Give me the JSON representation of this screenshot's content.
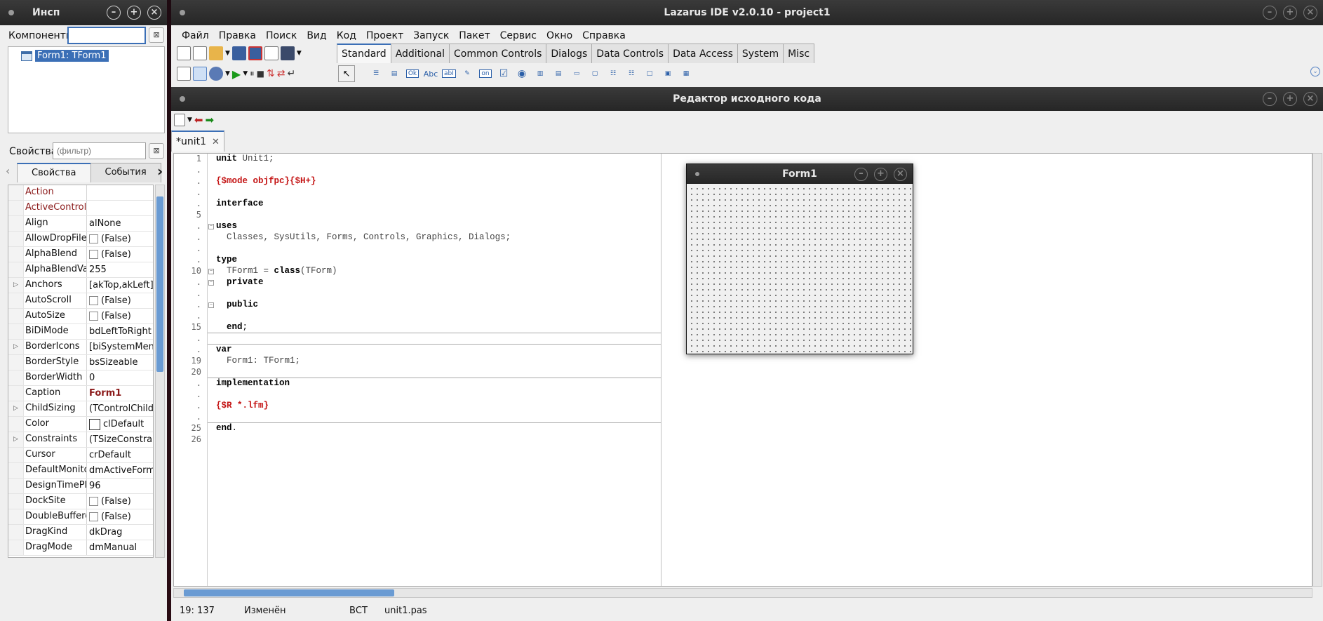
{
  "inspector": {
    "title": "Инсп",
    "components_label": "Компоненты",
    "components_value": "",
    "tree_item": "Form1: TForm1",
    "properties_label": "Свойства",
    "filter_placeholder": "(фильтр)",
    "tabs": [
      "Свойства",
      "События"
    ],
    "properties": [
      {
        "name": "Action",
        "value": "",
        "red": true
      },
      {
        "name": "ActiveControl",
        "value": "",
        "red": true
      },
      {
        "name": "Align",
        "value": "alNone"
      },
      {
        "name": "AllowDropFiles",
        "value": "(False)",
        "checkbox": true
      },
      {
        "name": "AlphaBlend",
        "value": "(False)",
        "checkbox": true
      },
      {
        "name": "AlphaBlendValue",
        "value": "255"
      },
      {
        "name": "Anchors",
        "value": "[akTop,akLeft]",
        "expand": true
      },
      {
        "name": "AutoScroll",
        "value": "(False)",
        "checkbox": true
      },
      {
        "name": "AutoSize",
        "value": "(False)",
        "checkbox": true
      },
      {
        "name": "BiDiMode",
        "value": "bdLeftToRight"
      },
      {
        "name": "BorderIcons",
        "value": "[biSystemMenu",
        "expand": true
      },
      {
        "name": "BorderStyle",
        "value": "bsSizeable"
      },
      {
        "name": "BorderWidth",
        "value": "0"
      },
      {
        "name": "Caption",
        "value": "Form1",
        "bold": true
      },
      {
        "name": "ChildSizing",
        "value": "(TControlChildS",
        "expand": true
      },
      {
        "name": "Color",
        "value": "clDefault",
        "color": true
      },
      {
        "name": "Constraints",
        "value": "(TSizeConstrain",
        "expand": true
      },
      {
        "name": "Cursor",
        "value": "crDefault"
      },
      {
        "name": "DefaultMonitor",
        "value": "dmActiveForm"
      },
      {
        "name": "DesignTimePPI",
        "value": "96"
      },
      {
        "name": "DockSite",
        "value": "(False)",
        "checkbox": true
      },
      {
        "name": "DoubleBuffered",
        "value": "(False)",
        "checkbox": true
      },
      {
        "name": "DragKind",
        "value": "dkDrag"
      },
      {
        "name": "DragMode",
        "value": "dmManual"
      }
    ]
  },
  "main": {
    "title": "Lazarus IDE v2.0.10 - project1",
    "menu": [
      "Файл",
      "Правка",
      "Поиск",
      "Вид",
      "Код",
      "Проект",
      "Запуск",
      "Пакет",
      "Сервис",
      "Окно",
      "Справка"
    ],
    "palette_tabs": [
      "Standard",
      "Additional",
      "Common Controls",
      "Dialogs",
      "Data Controls",
      "Data Access",
      "System",
      "Misc"
    ],
    "palette_labels": {
      "ok": "Ok",
      "abc": "Abc",
      "abi": "abI",
      "on": "on"
    }
  },
  "editor": {
    "title": "Редактор исходного кода",
    "file_tab": "*unit1",
    "gutter": [
      "1",
      ".",
      ".",
      ".",
      ".",
      "5",
      ".",
      ".",
      ".",
      ".",
      "10",
      ".",
      ".",
      ".",
      ".",
      "15",
      ".",
      ".",
      "19",
      "20",
      ".",
      ".",
      ".",
      ".",
      "25",
      "26"
    ],
    "status": {
      "position": "19: 137",
      "modified": "Изменён",
      "mode": "ВСТ",
      "file": "unit1.pas"
    }
  },
  "code": {
    "l1_kw": "unit",
    "l1_rest": " Unit1;",
    "l3": "{$mode objfpc}{$H+}",
    "l5": "interface",
    "l7": "uses",
    "l8": "  Classes, SysUtils, Forms, Controls, Graphics, Dialogs;",
    "l10": "type",
    "l11a": "  TForm1 = ",
    "l11kw": "class",
    "l11b": "(TForm)",
    "l12": "  private",
    "l14": "  public",
    "l16kw": "  end",
    "l16b": ";",
    "l18": "var",
    "l19": "  Form1: TForm1;",
    "l21": "implementation",
    "l23": "{$R *.lfm}",
    "l25kw": "end",
    "l25b": "."
  },
  "form1": {
    "title": "Form1"
  },
  "colors": {
    "accent": "#3b6fb6",
    "titlebar": "#2e2e2e",
    "directive": "#c41414"
  }
}
